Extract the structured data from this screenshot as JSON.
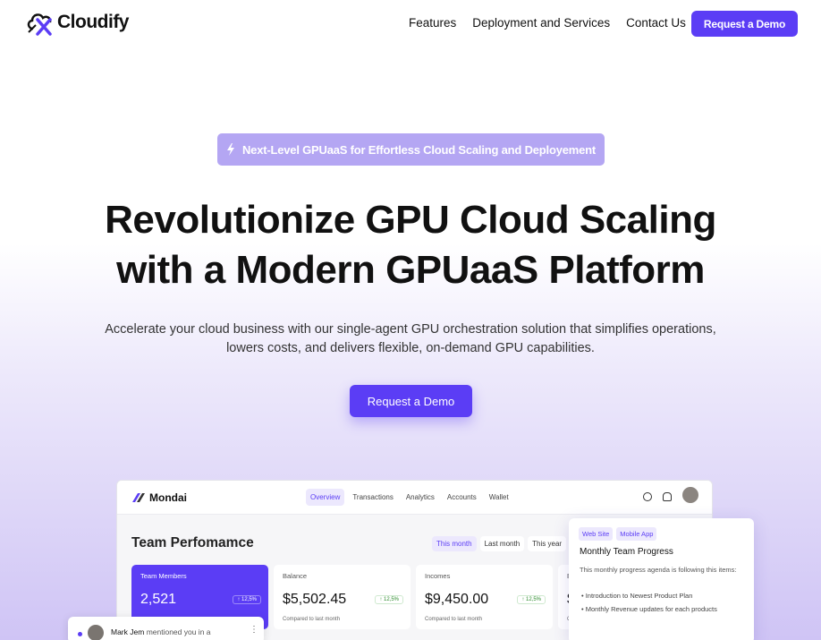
{
  "brand": {
    "name": "Cloudify",
    "accent": "#5b3df5"
  },
  "nav": {
    "links": [
      "Features",
      "Deployment and Services",
      "Contact Us"
    ],
    "cta": "Request a Demo"
  },
  "hero": {
    "badge": "Next-Level GPUaaS for Effortless Cloud Scaling and Deployement",
    "title_line1": "Revolutionize GPU Cloud Scaling",
    "title_line2": "with a Modern GPUaaS Platform",
    "subtitle_line1": "Accelerate your cloud business with our single-agent GPU orchestration solution that simplifies operations,",
    "subtitle_line2": "lowers costs, and delivers flexible, on-demand GPU capabilities.",
    "cta": "Request a Demo"
  },
  "dashboard": {
    "app_name": "Mondai",
    "tabs": [
      "Overview",
      "Transactions",
      "Analytics",
      "Accounts",
      "Wallet"
    ],
    "active_tab": "Overview",
    "section_title": "Team Perfomamce",
    "periods": [
      "This month",
      "Last month",
      "This year"
    ],
    "cards": [
      {
        "label": "Team Members",
        "value": "2,521",
        "change": "↑ 12,5%",
        "compare": ""
      },
      {
        "label": "Balance",
        "value": "$5,502.45",
        "change": "↑ 12,5%",
        "compare": "Compared to last month"
      },
      {
        "label": "Incomes",
        "value": "$9,450.00",
        "change": "↑ 12,5%",
        "compare": "Compared to last month"
      },
      {
        "label": "E",
        "value": "$",
        "change": "",
        "compare": "C"
      }
    ]
  },
  "popup": {
    "tags": [
      "Web Site",
      "Mobile App"
    ],
    "title": "Monthly Team Progress",
    "description": "This monthly progress agenda is following this items:",
    "items": [
      "Introduction to Newest Product Plan",
      "Monthly Revenue updates for each products"
    ]
  },
  "mention": {
    "name": "Mark Jem",
    "text": "mentioned you in a"
  }
}
